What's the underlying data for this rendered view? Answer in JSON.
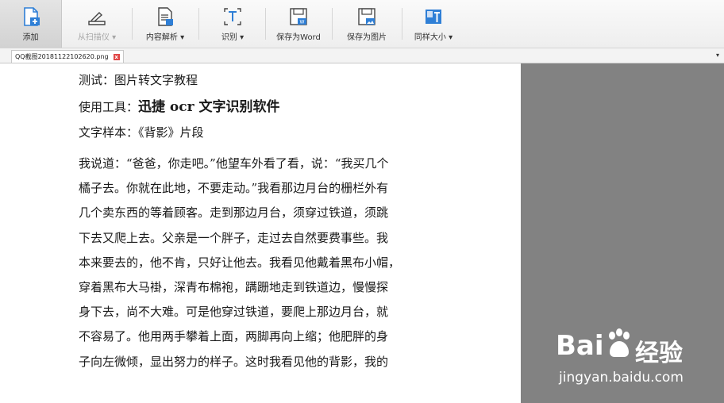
{
  "toolbar": {
    "add": "添加",
    "from_scanner": "从扫描仪",
    "content_parse": "内容解析",
    "recognize": "识别",
    "save_word": "保存为Word",
    "save_image": "保存为图片",
    "same_size": "同样大小",
    "dropdown_arrow": "▾"
  },
  "tab": {
    "filename": "QQ截图20181122102620.png",
    "close": "x",
    "menu_arrow": "▾"
  },
  "document": {
    "line1": "测试：图片转文字教程",
    "line2_prefix": "使用工具：",
    "line2_bold": "迅捷 ocr 文字识别软件",
    "line3": "文字样本：《背影》片段",
    "para": [
      "我说道：“爸爸，你走吧。”他望车外看了看，说：“我买几个",
      "橘子去。你就在此地，不要走动。”我看那边月台的栅栏外有",
      "几个卖东西的等着顾客。走到那边月台，须穿过铁道，须跳",
      "下去又爬上去。父亲是一个胖子，走过去自然要费事些。我",
      "本来要去的，他不肯，只好让他去。我看见他戴着黑布小帽，",
      "穿着黑布大马褂，深青布棉袍，蹒跚地走到铁道边，慢慢探",
      "身下去，尚不大难。可是他穿过铁道，要爬上那边月台，就",
      "不容易了。他用两手攀着上面，两脚再向上缩；他肥胖的身",
      "子向左微倾，显出努力的样子。这时我看见他的背影，我的"
    ]
  },
  "watermark": {
    "brand_left": "Bai",
    "brand_right": "经验",
    "url": "jingyan.baidu.com"
  },
  "colors": {
    "accent_blue": "#2f7fd6",
    "panel_gray": "#828282"
  }
}
